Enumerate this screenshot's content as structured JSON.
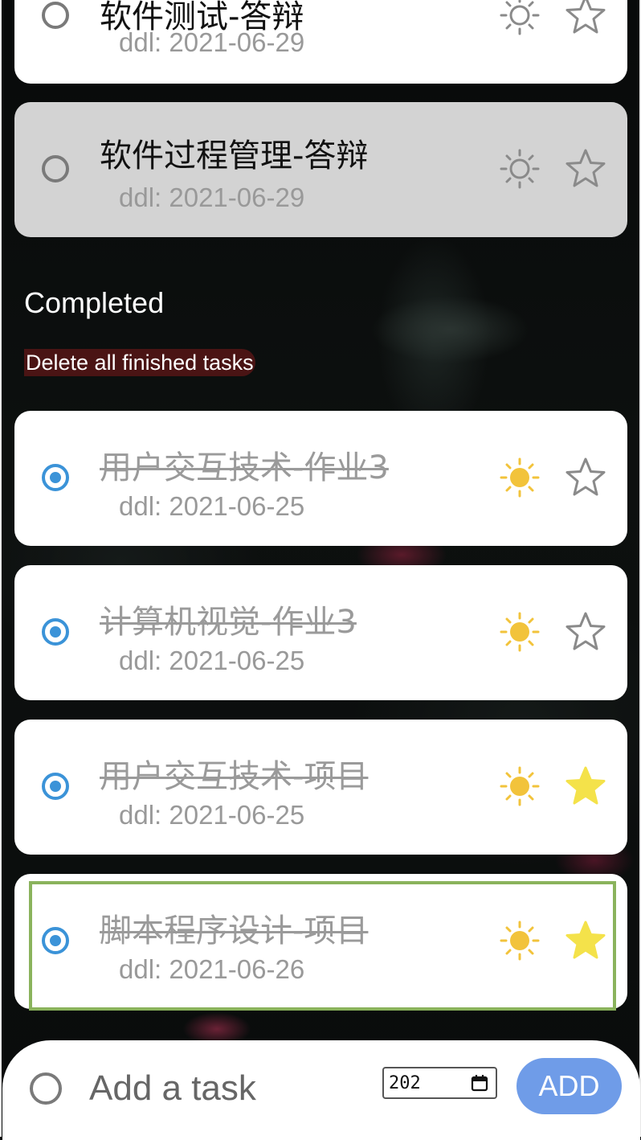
{
  "pending_tasks": [
    {
      "title": "软件测试-答辩",
      "ddl": "ddl: 2021-06-29",
      "starred": false
    },
    {
      "title": "软件过程管理-答辩",
      "ddl": "ddl: 2021-06-29",
      "starred": false
    }
  ],
  "completed": {
    "heading": "Completed",
    "delete_label": "Delete all finished tasks",
    "tasks": [
      {
        "title": "用户交互技术-作业3",
        "ddl": "ddl: 2021-06-25",
        "starred": false
      },
      {
        "title": "计算机视觉-作业3",
        "ddl": "ddl: 2021-06-25",
        "starred": false
      },
      {
        "title": "用户交互技术-项目",
        "ddl": "ddl: 2021-06-25",
        "starred": true
      },
      {
        "title": "脚本程序设计-项目",
        "ddl": "ddl: 2021-06-26",
        "starred": true
      }
    ]
  },
  "add_bar": {
    "placeholder": "Add a task",
    "date_value": "202",
    "add_label": "ADD"
  },
  "colors": {
    "accent_blue": "#3b93d8",
    "sun_active": "#f2c33b",
    "star_active": "#f4e24a",
    "add_button": "#6f9ce8",
    "highlight_border": "#8ab35c"
  }
}
